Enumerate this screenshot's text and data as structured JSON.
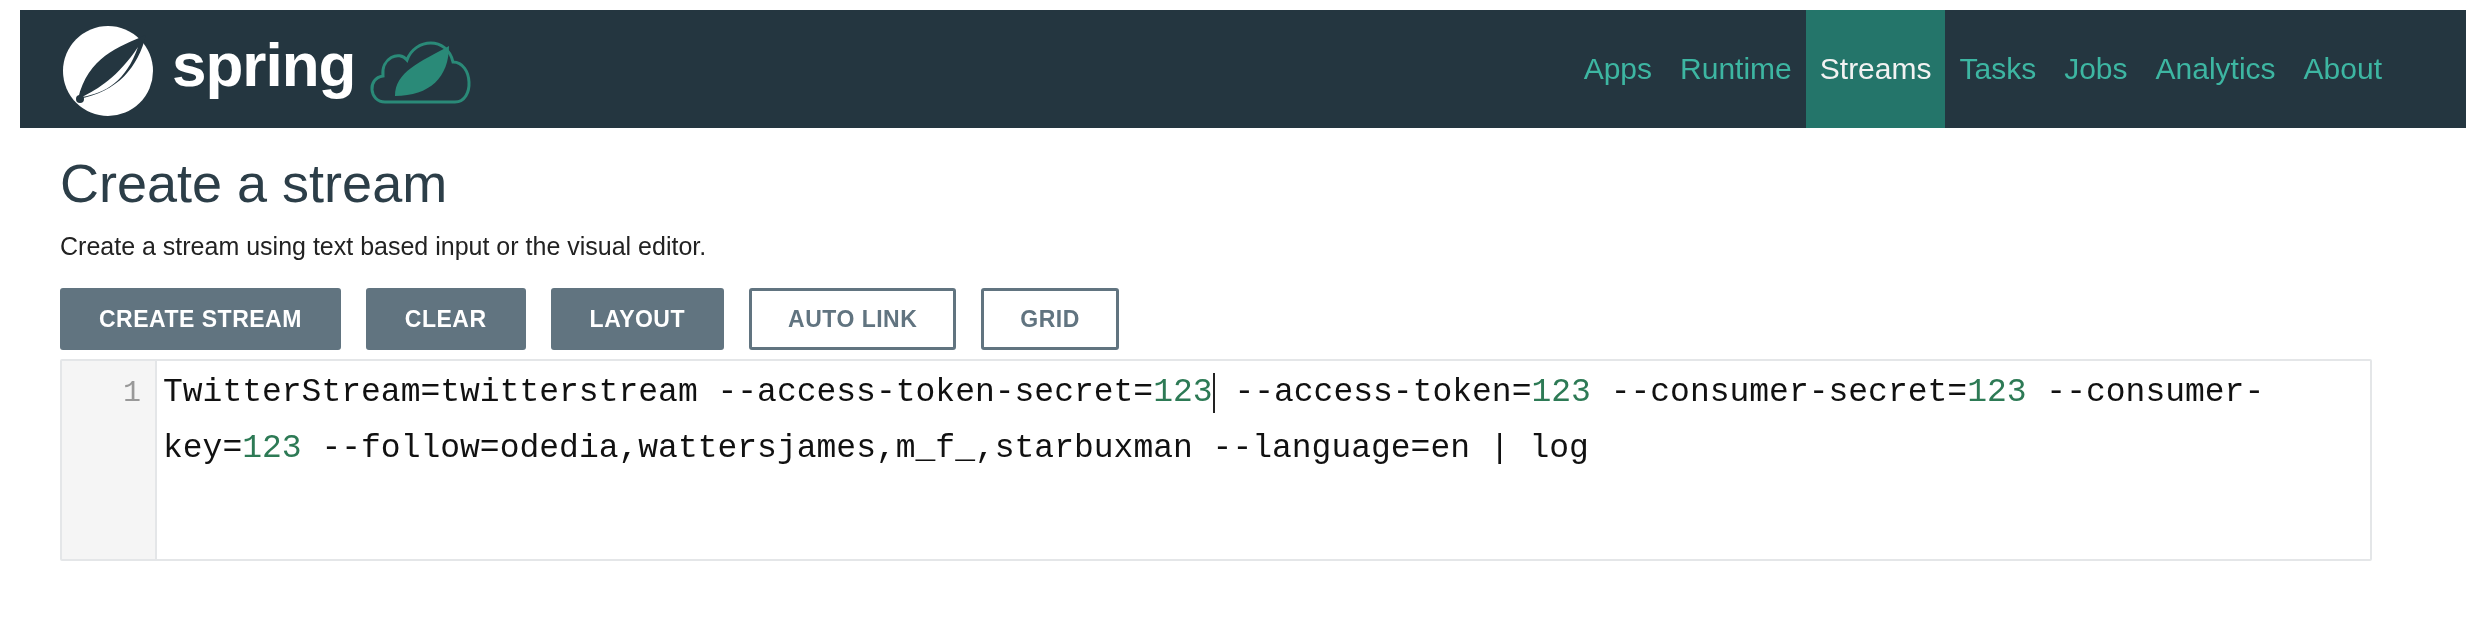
{
  "navbar": {
    "logo_text": "spring",
    "items": [
      {
        "label": "Apps",
        "selected": false
      },
      {
        "label": "Runtime",
        "selected": false
      },
      {
        "label": "Streams",
        "selected": true
      },
      {
        "label": "Tasks",
        "selected": false
      },
      {
        "label": "Jobs",
        "selected": false
      },
      {
        "label": "Analytics",
        "selected": false
      },
      {
        "label": "About",
        "selected": false
      }
    ]
  },
  "page": {
    "title": "Create a stream",
    "subtitle": "Create a stream using text based input or the visual editor."
  },
  "toolbar": [
    {
      "label": "CREATE STREAM",
      "kind": "filled"
    },
    {
      "label": "CLEAR",
      "kind": "filled"
    },
    {
      "label": "LAYOUT",
      "kind": "filled"
    },
    {
      "label": "AUTO LINK",
      "kind": "outline"
    },
    {
      "label": "GRID",
      "kind": "outline"
    }
  ],
  "editor": {
    "line_number": "1",
    "rows": [
      {
        "text": "TwitterStream=twitterstream --access-token-secret=123",
        "cursor": true,
        "rest": " --access-token=123 --consumer-secret=123 --consumer-"
      },
      {
        "text": "key=123 --follow=odedia,wattersjames,m_f_,starbuxman --language=en | log",
        "cursor": false
      }
    ]
  }
}
